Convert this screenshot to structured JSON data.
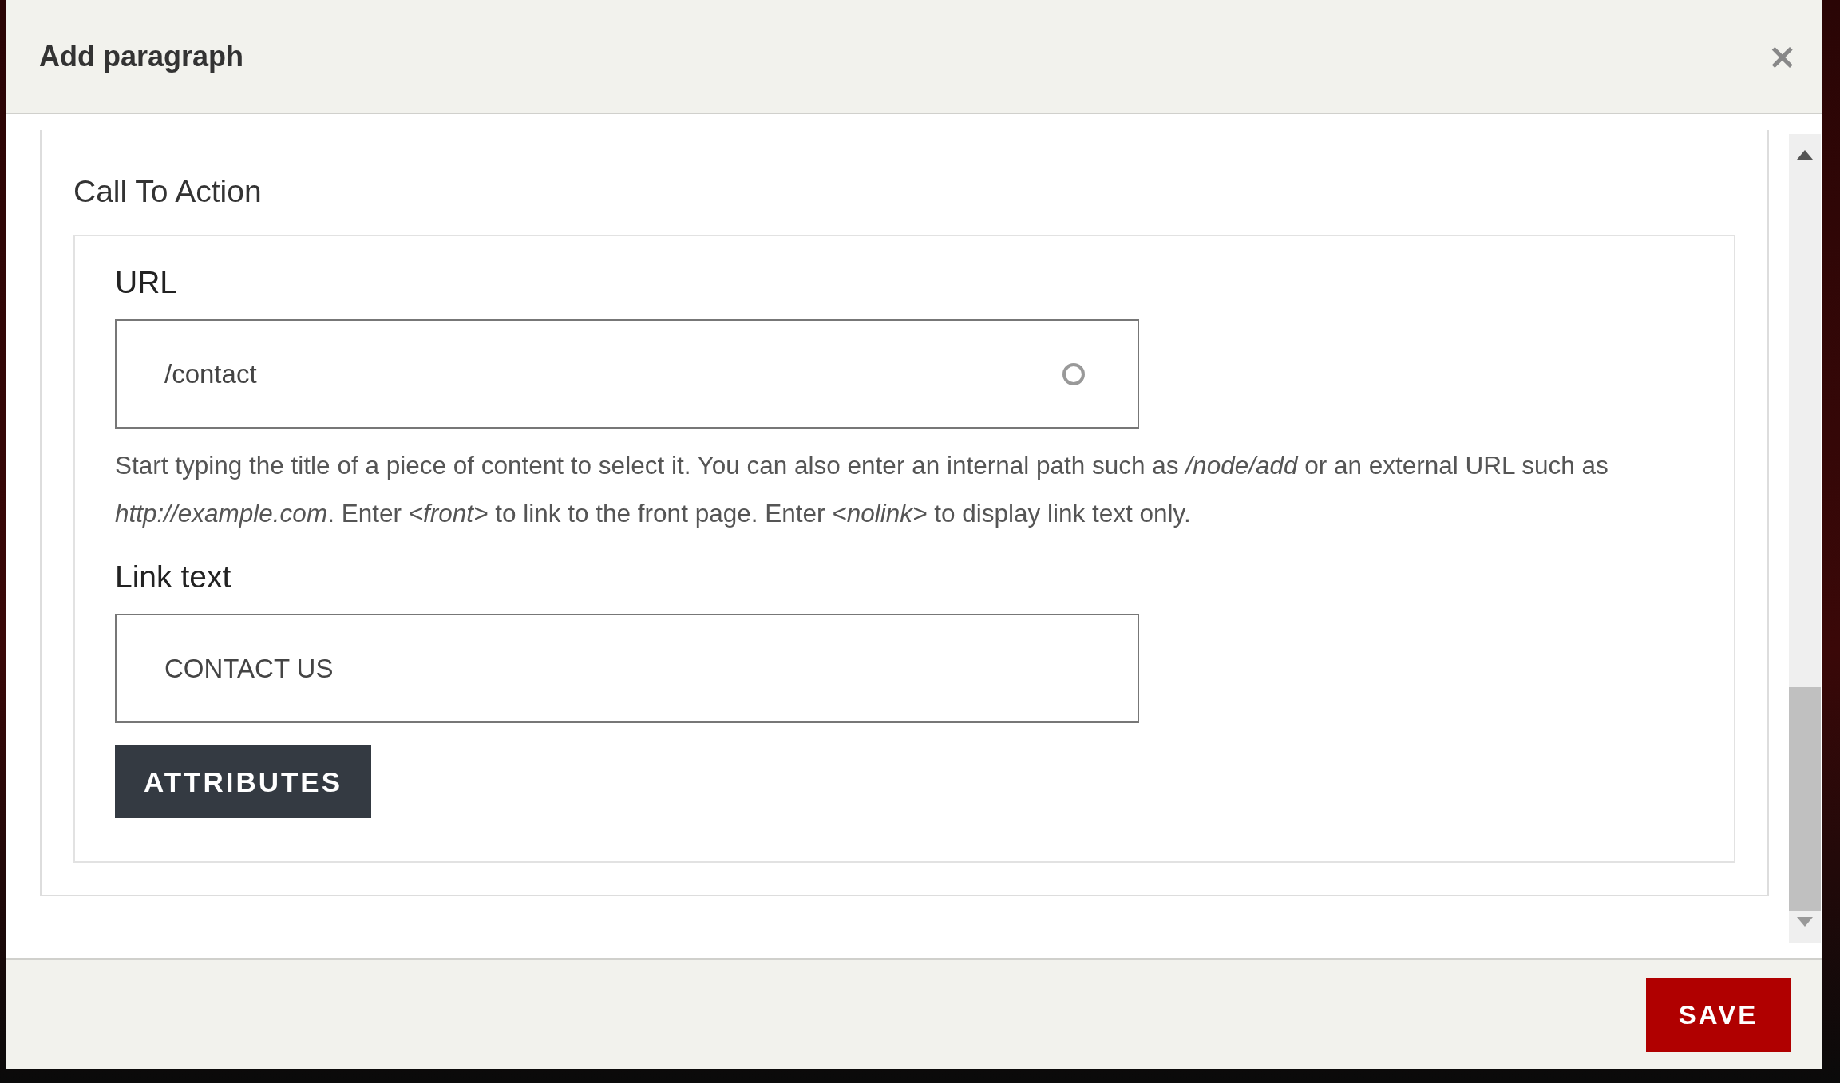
{
  "dialog": {
    "title": "Add paragraph",
    "close": "×"
  },
  "section": {
    "legend": "Call To Action",
    "fields": [
      {
        "label": "URL",
        "value": "/contact",
        "loading": true,
        "description": "Start typing the title of a piece of content to select it. You can also enter an internal path such as */node/add* or an external URL such as *http://example.com*. Enter *<front>* to link to the front page. Enter *<nolink>* to display link text only."
      },
      {
        "label": "Link text",
        "value": "CONTACT US",
        "loading": false
      }
    ],
    "button": "ATTRIBUTES"
  },
  "footer": {
    "button": "SAVE"
  }
}
